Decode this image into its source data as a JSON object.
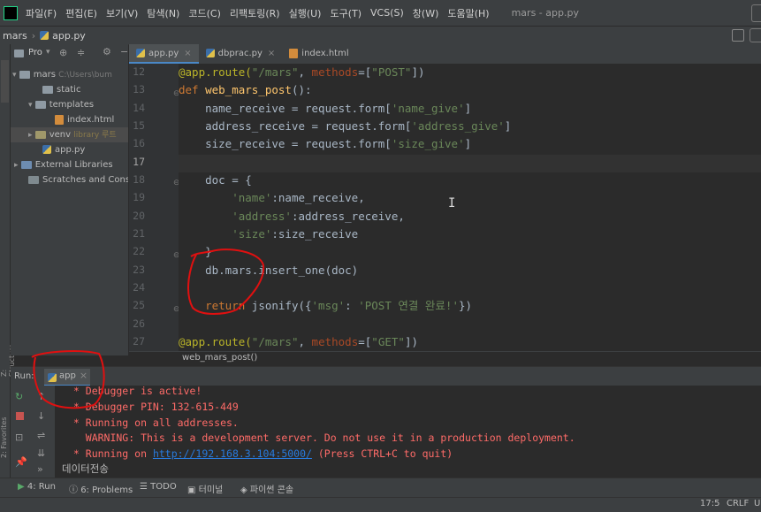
{
  "menu": {
    "items": [
      "파일(F)",
      "편집(E)",
      "보기(V)",
      "탐색(N)",
      "코드(C)",
      "리팩토링(R)",
      "실행(U)",
      "도구(T)",
      "VCS(S)",
      "창(W)",
      "도움말(H)"
    ],
    "window_title": "mars - app.py"
  },
  "breadcrumb": {
    "project": "mars",
    "file": "app.py"
  },
  "project_panel": {
    "title": "Pro",
    "tree": [
      {
        "label": "mars",
        "extra": "C:\\Users\\bum",
        "indent": 0,
        "kind": "folder",
        "expanded": true
      },
      {
        "label": "static",
        "extra": "",
        "indent": 1,
        "kind": "folder"
      },
      {
        "label": "templates",
        "extra": "",
        "indent": 1,
        "kind": "folder",
        "expanded": true
      },
      {
        "label": "index.html",
        "extra": "",
        "indent": 2,
        "kind": "html"
      },
      {
        "label": "venv",
        "extra": "library 루트",
        "indent": 1,
        "kind": "folder",
        "selected": true
      },
      {
        "label": "app.py",
        "extra": "",
        "indent": 1,
        "kind": "py"
      },
      {
        "label": "External Libraries",
        "extra": "",
        "indent": 0,
        "kind": "lib"
      },
      {
        "label": "Scratches and Consol",
        "extra": "",
        "indent": 0,
        "kind": "scratch"
      }
    ]
  },
  "editor": {
    "tabs": [
      {
        "label": "app.py",
        "active": true
      },
      {
        "label": "dbprac.py",
        "active": false
      },
      {
        "label": "index.html",
        "active": false
      }
    ],
    "line_numbers": [
      "12",
      "13",
      "14",
      "15",
      "16",
      "17",
      "18",
      "19",
      "20",
      "21",
      "22",
      "23",
      "24",
      "25",
      "26",
      "27"
    ],
    "current_line": "17",
    "breadcrumb_function": "web_mars_post()"
  },
  "run_panel": {
    "label": "Run:",
    "tab": "app",
    "console": [
      " * Debugger is active!",
      " * Debugger PIN: 132-615-449",
      " * Running on all addresses.",
      "   WARNING: This is a development server. Do not use it in a production deployment.",
      " * Running on ",
      "http://192.168.3.104:5000/",
      " (Press CTRL+C to quit)",
      "데이터전송"
    ]
  },
  "bottom_tools": [
    "4: Run",
    "6: Problems",
    "TODO",
    "터미널",
    "파이썬 콘솔"
  ],
  "status": {
    "position": "17:5",
    "line_ending": "CRLF",
    "encoding": "U"
  },
  "side_labels": {
    "structure": "Z: Structure",
    "favorites": "2: Favorites"
  },
  "colors": {
    "keyword": "#cc7832",
    "string": "#6a8759",
    "decorator": "#bbb529",
    "function": "#ffc66d",
    "console_red": "#ff6b68",
    "link": "#287bde",
    "annotation": "#e01010"
  }
}
